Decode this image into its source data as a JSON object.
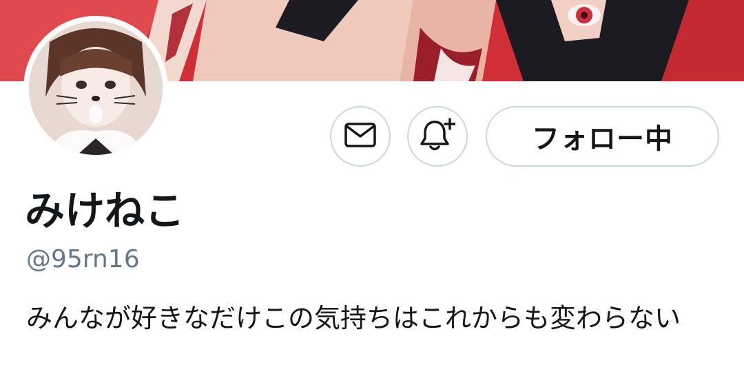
{
  "profile": {
    "display_name": "みけねこ",
    "handle": "@95rn16",
    "bio": "みんなが好きなだけこの気持ちはこれからも変わらない"
  },
  "actions": {
    "follow_label": "フォロー中"
  },
  "icons": {
    "message": "mail-icon",
    "notify": "bell-plus-icon"
  },
  "colors": {
    "border": "#ccd6dd",
    "handle_text": "#657786",
    "primary_text": "#14171a",
    "banner_red": "#d23436"
  }
}
